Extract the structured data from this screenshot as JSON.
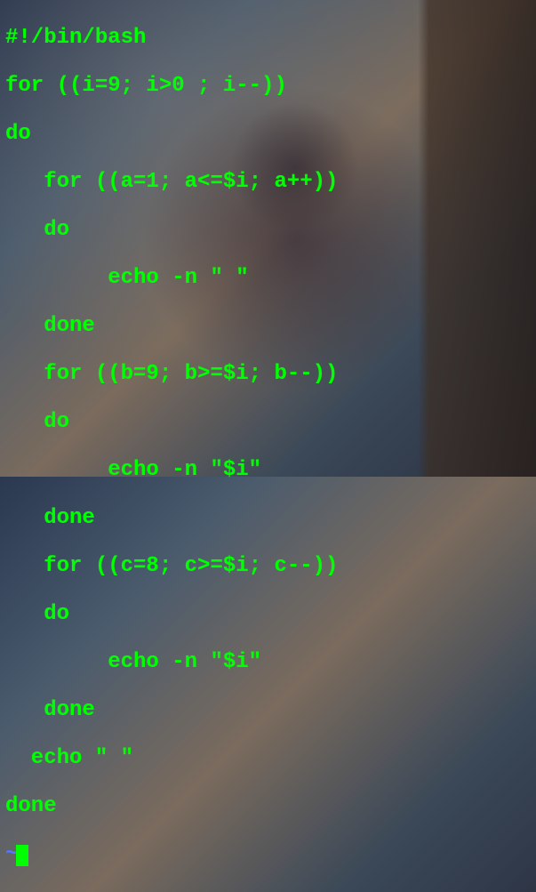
{
  "editor": {
    "lines": [
      "#!/bin/bash",
      "for ((i=9; i>0 ; i--))",
      "do",
      "   for ((a=1; a<=$i; a++))",
      "   do",
      "        echo -n \" \"",
      "   done",
      "   for ((b=9; b>=$i; b--))",
      "   do",
      "        echo -n \"$i\"",
      "   done",
      "   for ((c=8; c>=$i; c--))",
      "   do",
      "        echo -n \"$i\"",
      "   done",
      "  echo \" \"",
      "done"
    ],
    "empty_line_marker": "~",
    "filetype": "bash",
    "colors": {
      "code_text": "#00ff00",
      "tilde": "#5577ff"
    }
  }
}
